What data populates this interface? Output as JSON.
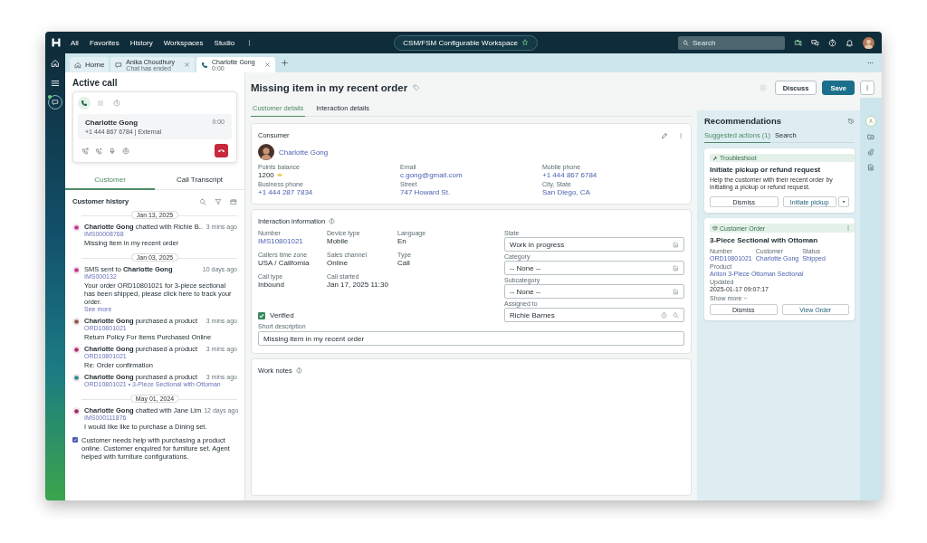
{
  "topbar": {
    "nav": [
      "All",
      "Favorites",
      "History",
      "Workspaces",
      "Studio"
    ],
    "workspace": "CSM/FSM Configurable Workspace",
    "search": {
      "placeholder": "Search"
    }
  },
  "tabs": [
    {
      "kind": "home",
      "label": "Home",
      "selected": false
    },
    {
      "kind": "chat",
      "label": "Anika Choudhury",
      "sub": "Chat has ended",
      "closable": true,
      "selected": false
    },
    {
      "kind": "phone",
      "label": "Charlotte Gong",
      "sub": "0:00",
      "closable": true,
      "selected": true
    }
  ],
  "active_call": {
    "title": "Active call",
    "modes": [
      {
        "kind": "phone",
        "selected": true
      },
      {
        "kind": "grid",
        "selected": false
      },
      {
        "kind": "clock",
        "selected": false
      }
    ],
    "caller": "Charlotte Gong",
    "number": "+1 444 867 6784 | External",
    "timer": "0:00"
  },
  "panel_tabs": [
    {
      "label": "Customer",
      "selected": true
    },
    {
      "label": "Call Transcript",
      "selected": false
    }
  ],
  "history": {
    "title": "Customer history",
    "items": [
      {
        "kind": "date",
        "label": "Jan 13, 2025"
      },
      {
        "kind": "entry",
        "color": "#c0398a",
        "title": "**Charlotte Gong** chatted with  Richie B..",
        "time": "3 mins ago",
        "ref": "IMS00008768",
        "body": "Missing item in my recent order"
      },
      {
        "kind": "date",
        "label": "Jan 03, 2025"
      },
      {
        "kind": "entry",
        "color": "#c0398a",
        "title": "SMS sent to **Charlotte Gong**",
        "time": "10 days ago",
        "ref": "IMS000132",
        "body": "Your order ORD10801021 for 3-piece sectional has been shipped, please click here to track your order.",
        "more": "See more"
      },
      {
        "kind": "entry",
        "color": "#8a5a3c",
        "title": "**Charlotte Gong** purchased a product",
        "time": "3 mins ago",
        "ref": "ORD10801021",
        "body": "Return Policy For Items Purchased Online"
      },
      {
        "kind": "entry",
        "color": "#b0306a",
        "title": "**Charlotte Gong** purchased a product",
        "time": "3 mins ago",
        "ref": "ORD10801021",
        "body": "Re: Order confirmation"
      },
      {
        "kind": "entry",
        "color": "#2b8a8a",
        "title": "**Charlotte Gong** purchased a product",
        "time": "3 mins ago",
        "ref": "ORD10801021 • 3-Piece Sectional with Ottoman"
      },
      {
        "kind": "date",
        "label": "May 01, 2024"
      },
      {
        "kind": "entry",
        "color": "#a02a6a",
        "title": "**Charlotte Gong** chatted with  Jane Lim",
        "time": "12 days ago",
        "ref": "IMS000111876",
        "body": "I would like like to purchase a Dining set."
      },
      {
        "kind": "note",
        "color": "#4b5fb0",
        "body": "Customer needs help with purchasing a product online. Customer enquired for furniture set. Agent helped with furniture configurations."
      }
    ]
  },
  "record": {
    "title": "Missing item in my recent order",
    "buttons": [
      {
        "label": "Discuss",
        "kind": "secondary"
      },
      {
        "label": "Save",
        "kind": "primary"
      }
    ],
    "tabs": [
      {
        "label": "Customer details",
        "selected": true
      },
      {
        "label": "Interaction details",
        "selected": false
      }
    ]
  },
  "consumer": {
    "title": "Consumer",
    "name": "Charlotte Gong",
    "fields": [
      {
        "label": "Points balance",
        "value": "1200",
        "kind": "points"
      },
      {
        "label": "Email",
        "value": "c.gong@gmail.com",
        "kind": "link"
      },
      {
        "label": "Mobile phone",
        "value": "+1 444 867 6784",
        "kind": "link"
      },
      {
        "label": "Business phone",
        "value": "+1 444 287 7834",
        "kind": "link"
      },
      {
        "label": "Street",
        "value": "747 Howard St.",
        "kind": "link"
      },
      {
        "label": "City, State",
        "value": "San Diego, CA",
        "kind": "link"
      }
    ]
  },
  "interaction": {
    "title": "Interaction information",
    "fields": [
      {
        "label": "Number",
        "value": "IMS10801021",
        "kind": "link"
      },
      {
        "label": "Device type",
        "value": "Mobile",
        "kind": "text"
      },
      {
        "label": "Language",
        "value": "En",
        "kind": "text"
      },
      {
        "label": "Callers time zone",
        "value": "USA / California",
        "kind": "text"
      },
      {
        "label": "Sales channel",
        "value": "Online",
        "kind": "text"
      },
      {
        "label": "Type",
        "value": "Call",
        "kind": "text"
      },
      {
        "label": "Call type",
        "value": "Inbound",
        "kind": "text"
      },
      {
        "label": "Call started",
        "value": "Jan 17, 2025 11:30",
        "kind": "text"
      }
    ],
    "inputs": [
      {
        "label": "State",
        "value": "Work in progress",
        "kind": "select"
      },
      {
        "label": "Category",
        "value": "-- None --",
        "kind": "select"
      },
      {
        "label": "Subcategory",
        "value": "-- None --",
        "kind": "select"
      },
      {
        "label": "Assigned to",
        "value": "Richie Barnes",
        "kind": "reference"
      }
    ],
    "verified": {
      "label": "Verified",
      "checked": true
    },
    "short_description": {
      "label": "Short description",
      "value": "Missing item in my recent order"
    }
  },
  "work_notes": {
    "title": "Work notes"
  },
  "recommendations": {
    "title": "Recommendations",
    "tabs": [
      {
        "label": "Suggested actions (1)",
        "selected": true
      },
      {
        "label": "Search",
        "selected": false
      }
    ],
    "cards": [
      {
        "kind": "action",
        "tag": "Troubleshoot",
        "title": "Initiate pickup or refund request",
        "description": "Help the customer with their recent order by initiating a pickup or refund request.",
        "dismiss": "Dismiss",
        "action": "Initiate pickup"
      },
      {
        "kind": "record",
        "tag": "Customer Order",
        "title": "3-Piece Sectional with Ottoman",
        "fields": [
          {
            "label": "Number",
            "value": "ORD10801021"
          },
          {
            "label": "Customer",
            "value": "Charlotte Gong"
          },
          {
            "label": "Status",
            "value": "Shipped"
          }
        ],
        "product_label": "Product",
        "product": "Anton 3-Piece Ottoman Sectional",
        "updated_label": "Updated",
        "updated": "2025-01-17 09:07:17",
        "more": "Show more",
        "dismiss": "Dismiss",
        "action": "View Order"
      }
    ]
  },
  "side_rail": [
    {
      "kind": "agent",
      "selected": true
    },
    {
      "kind": "folder",
      "selected": false
    },
    {
      "kind": "clip",
      "selected": false
    },
    {
      "kind": "doc",
      "selected": false
    }
  ]
}
